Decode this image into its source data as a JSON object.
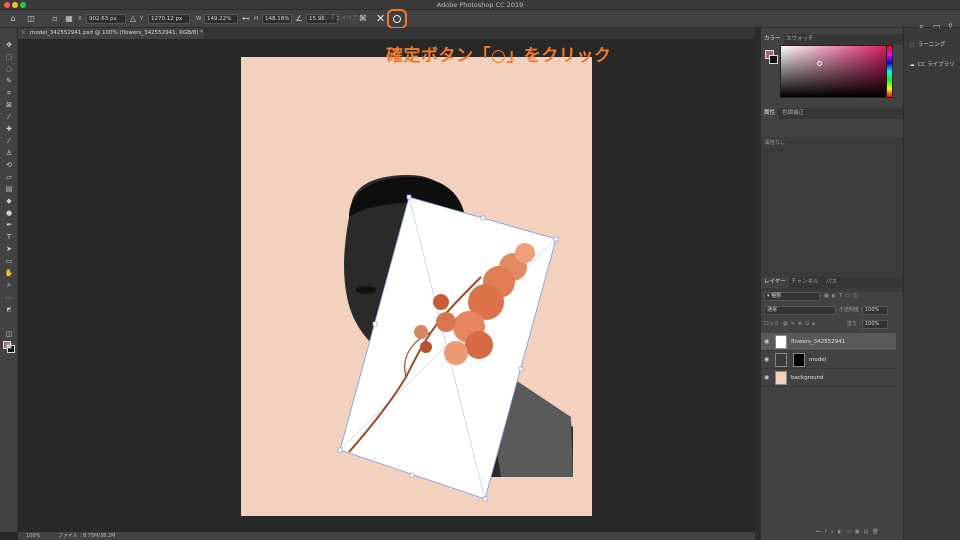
{
  "window": {
    "title": "Adobe Photoshop CC 2019",
    "traffic_colors": [
      "#fc5f57",
      "#fdbc2e",
      "#28c840"
    ]
  },
  "options_bar": {
    "x_label": "X",
    "x_value": "902.63 px",
    "y_label": "Y",
    "y_value": "1270.12 px",
    "w_label": "W",
    "w_value": "149.22%",
    "h_label": "H",
    "h_value": "148.18%",
    "angle_value": "15.96",
    "interpolation": "アンチエイリアス",
    "cancel_icon": "x-icon",
    "commit_icon": "circle-icon"
  },
  "document_tab": {
    "label": "model_342552941.psd @ 100% (flowers_342552941, RGB/8) *"
  },
  "annotation": {
    "text": "確定ボタン「○」をクリック",
    "color": "#f07a2a"
  },
  "status_bar": {
    "zoom": "100%",
    "file_info": "ファイル : 8.75M/38.2M"
  },
  "color_panel": {
    "tabs": [
      "カラー",
      "スウォッチ"
    ],
    "foreground": "#a26b7c",
    "background": "#111111"
  },
  "properties_panel": {
    "tabs": [
      "属性",
      "色調補正"
    ],
    "empty_text": "属性なし"
  },
  "layers_panel": {
    "tabs": [
      "レイヤー",
      "チャンネル",
      "パス"
    ],
    "blend_mode": "通常",
    "opacity_label": "不透明度 :",
    "opacity_value": "100%",
    "fill_label": "塗り :",
    "fill_value": "100%",
    "lock_label": "ロック :",
    "layers": [
      {
        "name": "flowers_342552941",
        "selected": true
      },
      {
        "name": "model",
        "selected": false
      },
      {
        "name": "background",
        "selected": false
      }
    ]
  },
  "side_panels": {
    "items": [
      "ラーニング",
      "CC ライブラリ"
    ]
  }
}
